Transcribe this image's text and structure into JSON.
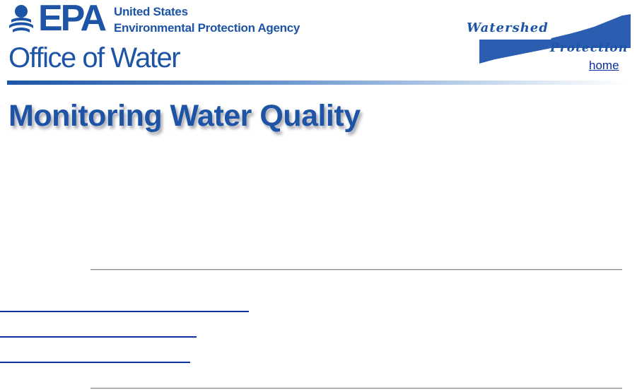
{
  "header": {
    "agency_acronym": "EPA",
    "agency_line1": "United States",
    "agency_line2": "Environmental Protection Agency",
    "office_title": "Office of Water"
  },
  "watershed": {
    "word1": "Watershed",
    "word2": "Protection",
    "home_label": "home"
  },
  "page": {
    "heading": "Monitoring Water Quality"
  },
  "colors": {
    "brand_blue": "#1d54a6",
    "link_blue": "#0a2f9e"
  },
  "icons": {
    "epa_mark": "epa-logo-icon",
    "watershed": "watershed-wave-icon"
  }
}
